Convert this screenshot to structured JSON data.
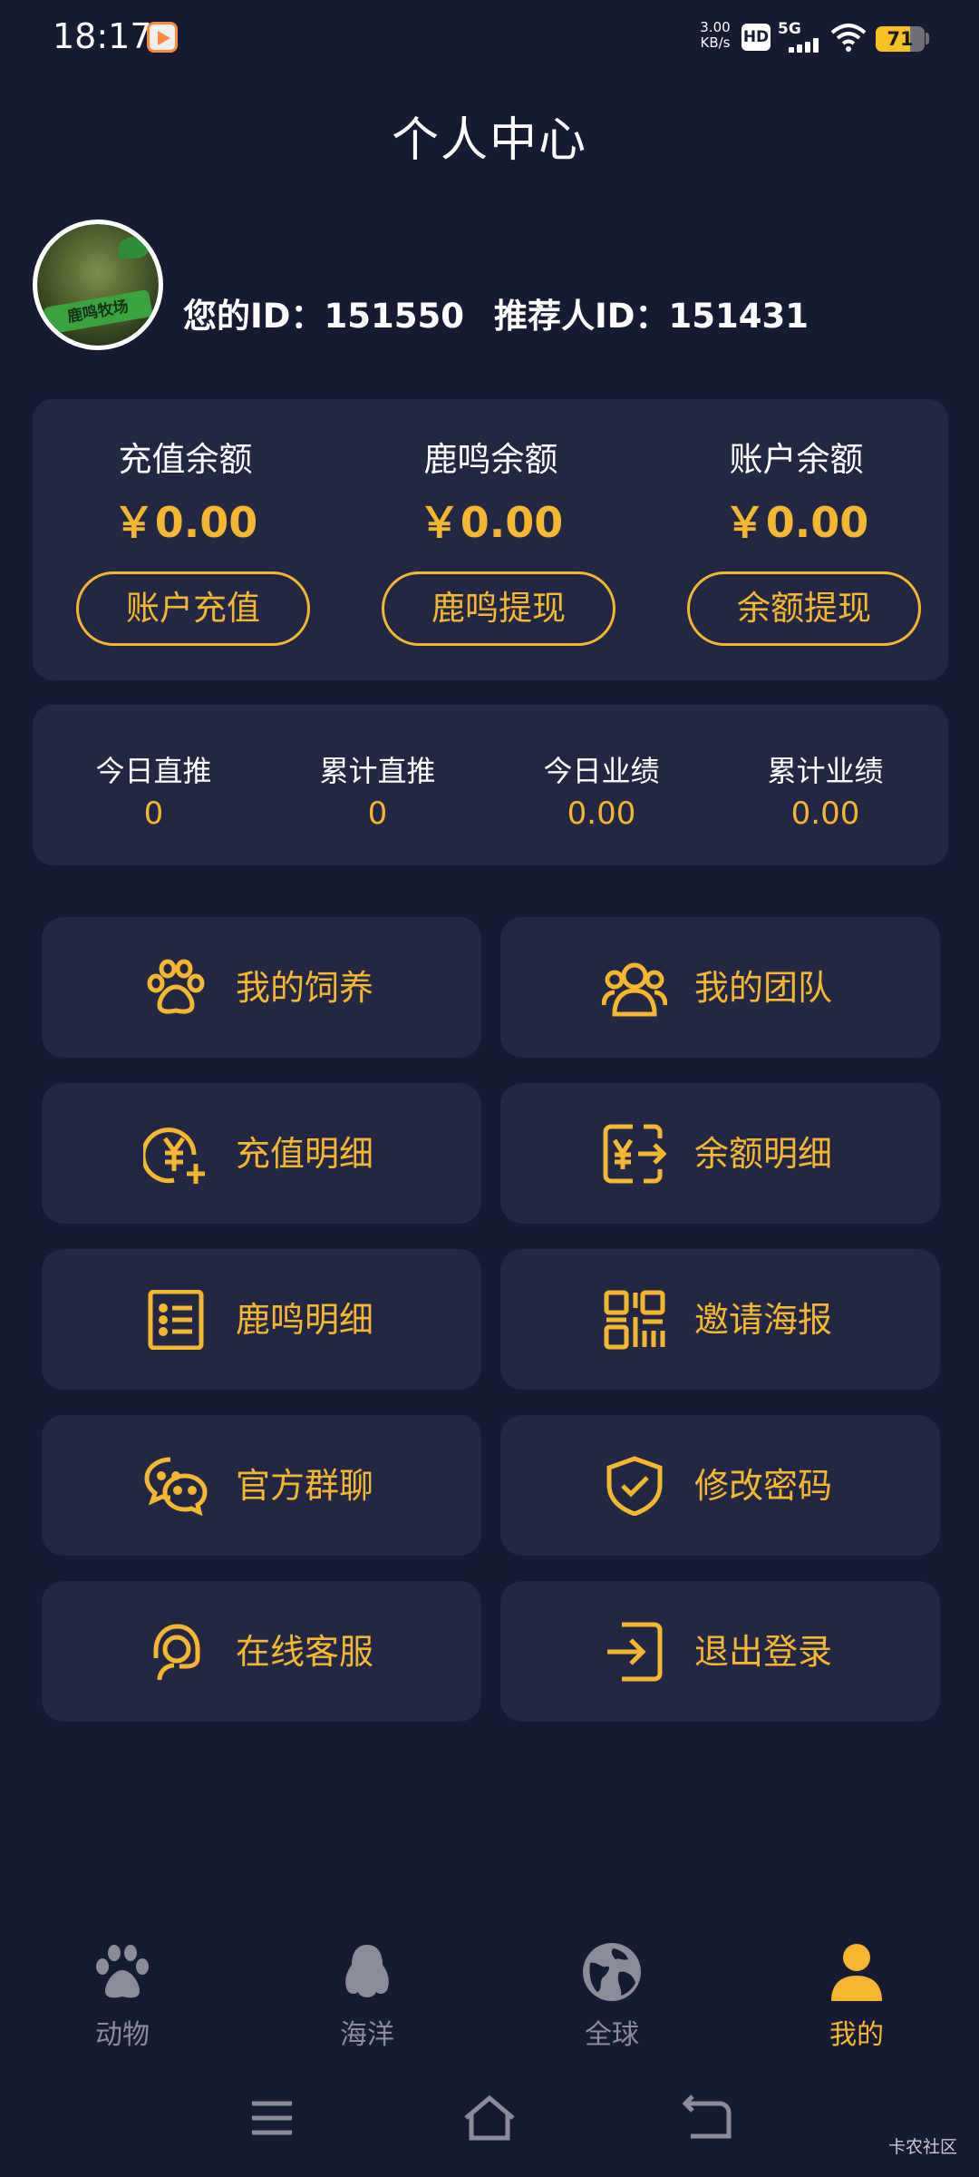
{
  "status_bar": {
    "time": "18:17",
    "net_speed": "3.00",
    "net_unit": "KB/s",
    "hd": "HD",
    "network": "5G",
    "battery_percent": 71
  },
  "header": {
    "title": "个人中心"
  },
  "profile": {
    "user_id_label": "您的ID：",
    "user_id": "151550",
    "referrer_label": "推荐人ID：",
    "referrer_id": "151431",
    "avatar_text": "鹿鸣牧场"
  },
  "balances": [
    {
      "label": "充值余额",
      "value": "￥0.00",
      "button": "账户充值"
    },
    {
      "label": "鹿鸣余额",
      "value": "￥0.00",
      "button": "鹿鸣提现"
    },
    {
      "label": "账户余额",
      "value": "￥0.00",
      "button": "余额提现"
    }
  ],
  "stats": [
    {
      "label": "今日直推",
      "value": "0"
    },
    {
      "label": "累计直推",
      "value": "0"
    },
    {
      "label": "今日业绩",
      "value": "0.00"
    },
    {
      "label": "累计业绩",
      "value": "0.00"
    }
  ],
  "menu": [
    {
      "label": "我的饲养",
      "icon": "paw-icon"
    },
    {
      "label": "我的团队",
      "icon": "team-icon"
    },
    {
      "label": "充值明细",
      "icon": "yen-add-icon"
    },
    {
      "label": "余额明细",
      "icon": "yen-transfer-icon"
    },
    {
      "label": "鹿鸣明细",
      "icon": "list-icon"
    },
    {
      "label": "邀请海报",
      "icon": "qrcode-icon"
    },
    {
      "label": "官方群聊",
      "icon": "chat-icon"
    },
    {
      "label": "修改密码",
      "icon": "shield-check-icon"
    },
    {
      "label": "在线客服",
      "icon": "headset-icon"
    },
    {
      "label": "退出登录",
      "icon": "logout-icon"
    }
  ],
  "tabs": [
    {
      "label": "动物",
      "icon": "paw-icon",
      "active": false
    },
    {
      "label": "海洋",
      "icon": "penguin-icon",
      "active": false
    },
    {
      "label": "全球",
      "icon": "globe-icon",
      "active": false
    },
    {
      "label": "我的",
      "icon": "person-icon",
      "active": true
    }
  ],
  "watermark": "卡农社区",
  "colors": {
    "background": "#161a33",
    "card": "#232744",
    "accent": "#f5b72f",
    "inactive_tab": "#8a8c99"
  }
}
